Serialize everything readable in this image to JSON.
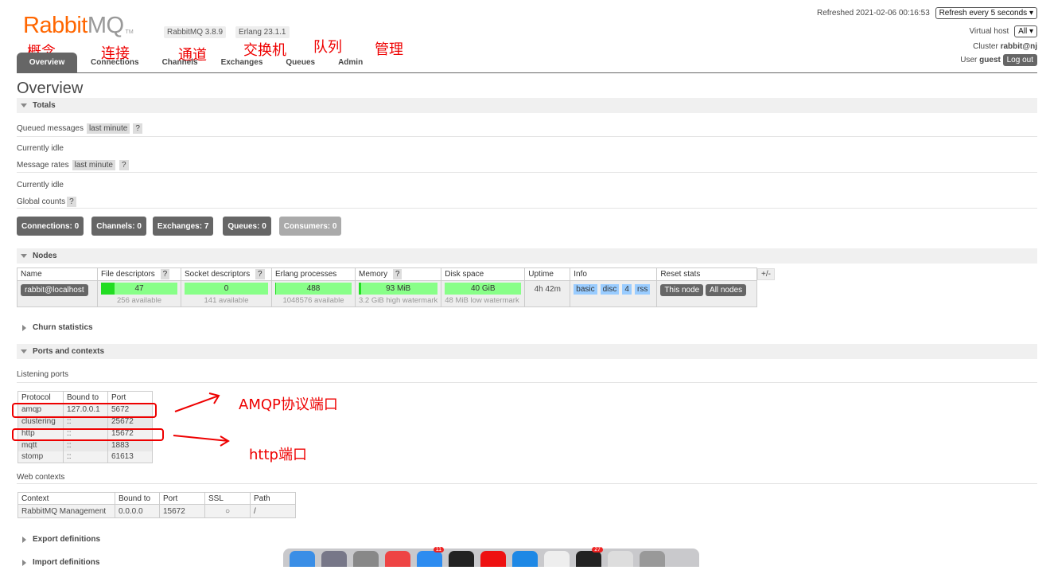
{
  "header": {
    "logo_main": "Rabbit",
    "logo_mq": "MQ",
    "logo_tm": "TM",
    "version_rabbit": "RabbitMQ 3.8.9",
    "version_erlang": "Erlang 23.1.1",
    "refreshed": "Refreshed 2021-02-06 00:16:53",
    "refresh_select": "Refresh every 5 seconds",
    "vhost_label": "Virtual host",
    "vhost_select": "All",
    "cluster_label": "Cluster",
    "cluster_name": "rabbit@nj",
    "user_label": "User",
    "user_name": "guest",
    "logout": "Log out"
  },
  "tabs": [
    {
      "label": "Overview",
      "anno": "概念"
    },
    {
      "label": "Connections",
      "anno": "连接"
    },
    {
      "label": "Channels",
      "anno": "通道"
    },
    {
      "label": "Exchanges",
      "anno": "交换机"
    },
    {
      "label": "Queues",
      "anno": "队列"
    },
    {
      "label": "Admin",
      "anno": "管理"
    }
  ],
  "page_title": "Overview",
  "totals": {
    "heading": "Totals",
    "queued_label": "Queued messages",
    "queued_range": "last minute",
    "help": "?",
    "idle1": "Currently idle",
    "rates_label": "Message rates",
    "rates_range": "last minute",
    "idle2": "Currently idle",
    "global_label": "Global counts"
  },
  "counts": {
    "connections": "Connections: 0",
    "channels": "Channels: 0",
    "exchanges": "Exchanges: 7",
    "queues": "Queues: 0",
    "consumers": "Consumers: 0"
  },
  "nodes": {
    "heading": "Nodes",
    "headers": [
      "Name",
      "File descriptors",
      "Socket descriptors",
      "Erlang processes",
      "Memory",
      "Disk space",
      "Uptime",
      "Info",
      "Reset stats"
    ],
    "plus_minus": "+/-",
    "row": {
      "name": "rabbit@localhost",
      "fd": "47",
      "fd_sub": "256 available",
      "fd_fill": 0.18,
      "sd": "0",
      "sd_sub": "141 available",
      "sd_fill": 0,
      "ep": "488",
      "ep_sub": "1048576 available",
      "ep_fill": 0.01,
      "mem": "93 MiB",
      "mem_sub": "3.2 GiB high watermark",
      "mem_fill": 0.03,
      "disk": "40 GiB",
      "disk_sub": "48 MiB low watermark",
      "disk_fill": 0,
      "uptime": "4h 42m",
      "info": [
        "basic",
        "disc",
        "4",
        "rss"
      ],
      "reset_this": "This node",
      "reset_all": "All nodes"
    }
  },
  "churn": "Churn statistics",
  "ports": {
    "heading": "Ports and contexts",
    "listening_label": "Listening ports",
    "headers": [
      "Protocol",
      "Bound to",
      "Port"
    ],
    "rows": [
      [
        "amqp",
        "127.0.0.1",
        "5672"
      ],
      [
        "clustering",
        "::",
        "25672"
      ],
      [
        "http",
        "::",
        "15672"
      ],
      [
        "mqtt",
        "::",
        "1883"
      ],
      [
        "stomp",
        "::",
        "61613"
      ]
    ],
    "web_label": "Web contexts",
    "web_headers": [
      "Context",
      "Bound to",
      "Port",
      "SSL",
      "Path"
    ],
    "web_row": [
      "RabbitMQ Management",
      "0.0.0.0",
      "15672",
      "○",
      "/"
    ],
    "anno_amqp": "AMQP协议端口",
    "anno_http": "http端口"
  },
  "export": "Export definitions",
  "import": "Import definitions",
  "dock": {
    "badges": [
      "11",
      "27"
    ],
    "icons": [
      {
        "name": "finder",
        "color": "#3a8ee6"
      },
      {
        "name": "rocket",
        "color": "#778"
      },
      {
        "name": "settings",
        "color": "#888"
      },
      {
        "name": "chrome",
        "color": "#e44"
      },
      {
        "name": "mail",
        "color": "#2d8cf0"
      },
      {
        "name": "terminal",
        "color": "#222"
      },
      {
        "name": "youdao",
        "color": "#e11"
      },
      {
        "name": "vscode",
        "color": "#1e88e5"
      },
      {
        "name": "typora",
        "color": "#eee"
      },
      {
        "name": "qq",
        "color": "#222"
      },
      {
        "name": "preview",
        "color": "#ddd"
      },
      {
        "name": "trash",
        "color": "#999"
      }
    ]
  }
}
